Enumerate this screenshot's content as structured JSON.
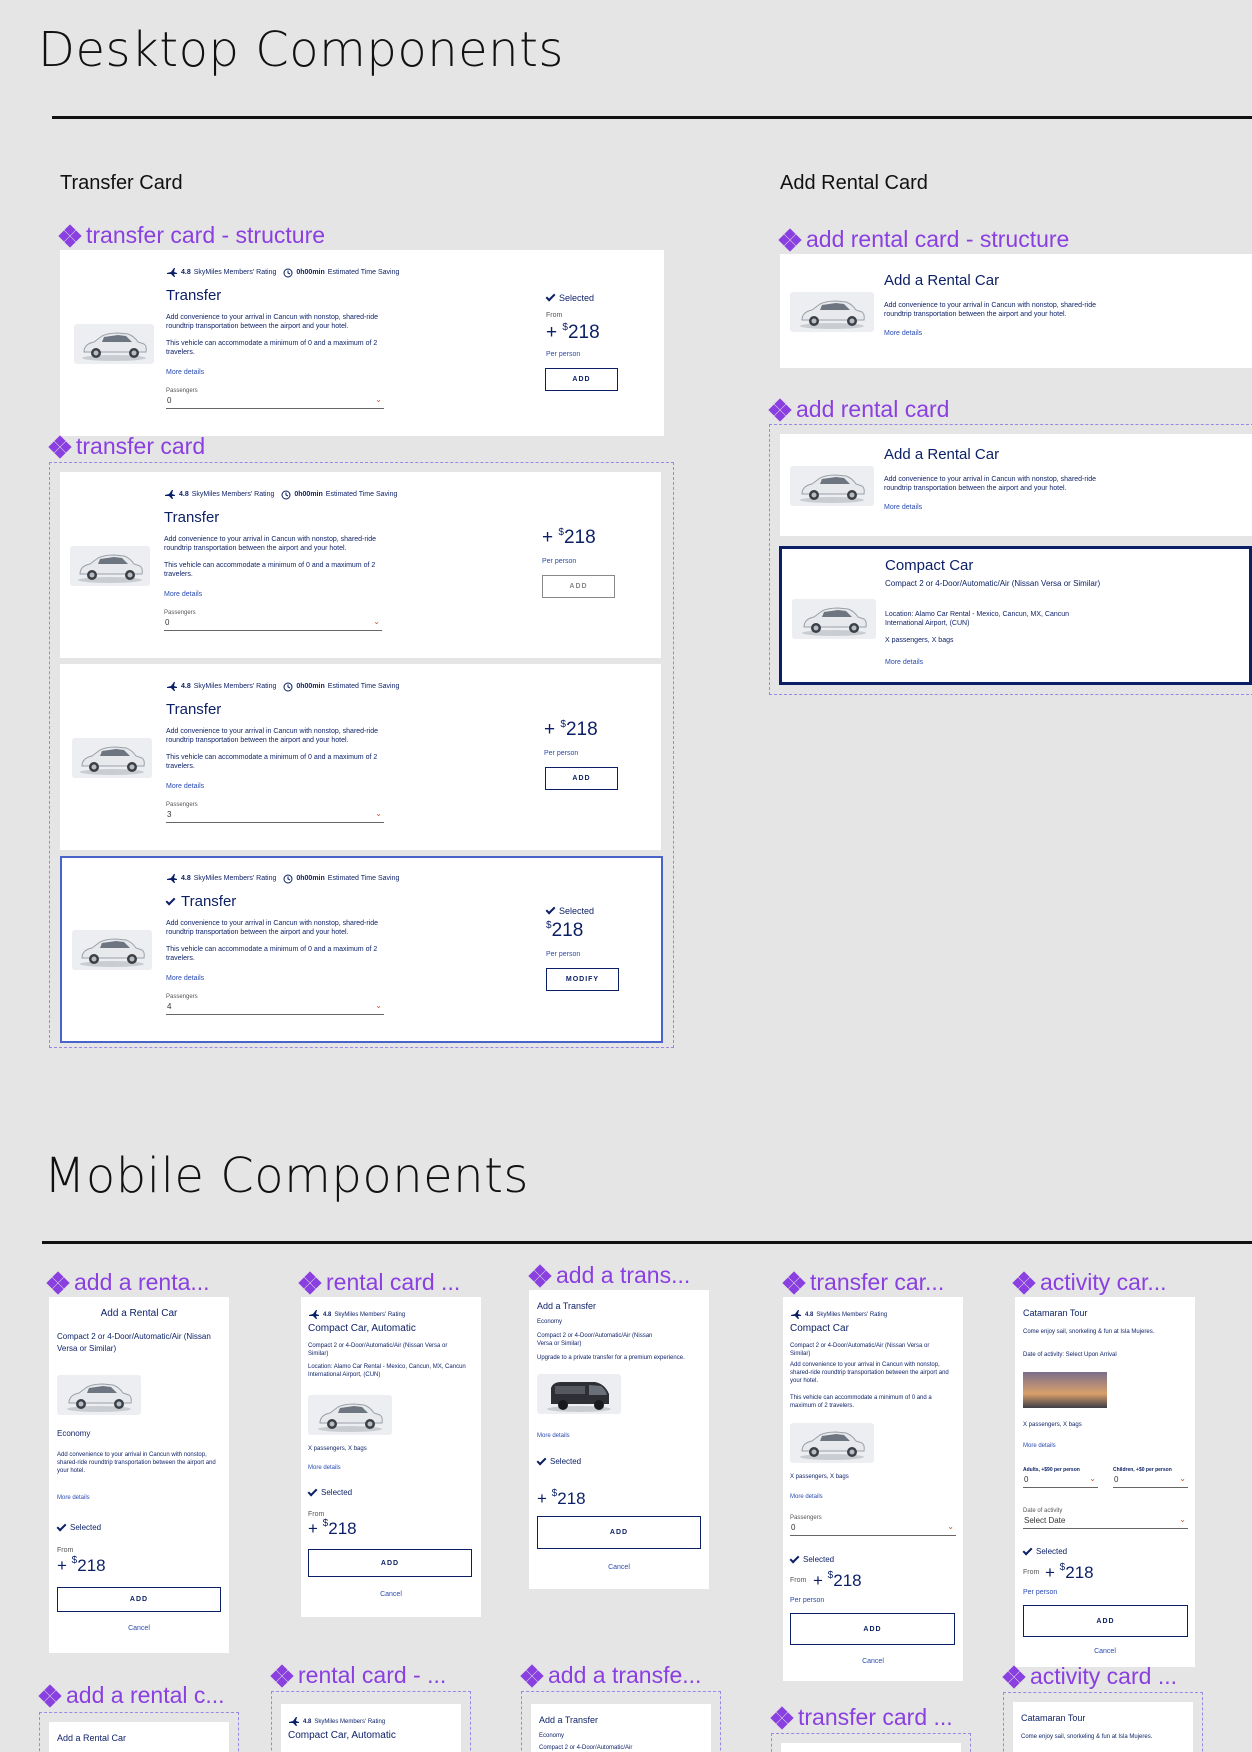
{
  "desktop": {
    "title": "Desktop Components",
    "transfer_card_heading": "Transfer Card",
    "add_rental_heading": "Add Rental Card"
  },
  "mobile": {
    "title": "Mobile Components"
  },
  "labels": {
    "transfer_structure": "transfer card - structure",
    "transfer_card": "transfer card",
    "add_rental_structure": "add rental card - structure",
    "add_rental_card": "add rental card",
    "m_add_renta": "add a renta...",
    "m_rental_card": "rental card ...",
    "m_add_trans": "add a trans...",
    "m_transfer_car": "transfer car...",
    "m_activity_car": "activity car...",
    "m_add_rental_c": "add a rental c...",
    "m_rental_card_dash": "rental card - ...",
    "m_add_transfe": "add a transfe...",
    "m_transfer_card_dots": "transfer card ...",
    "m_activity_card_dots": "activity card ..."
  },
  "transfer": {
    "rating_value": "4.8",
    "rating_label": "SkyMiles Members' Rating",
    "time_value": "0h00min",
    "time_label": "Estimated Time Saving",
    "title": "Transfer",
    "desc1": "Add convenience to your arrival in Cancun with nonstop, shared-ride roundtrip transportation between the airport and your hotel.",
    "desc2": "This vehicle can accommodate a minimum of 0 and a maximum of 2 travelers.",
    "more_details": "More details",
    "passengers_label": "Passengers",
    "selected": "Selected",
    "from": "From",
    "plus": "+",
    "currency": "$",
    "price": "218",
    "per_person": "Per person",
    "add": "ADD",
    "modify": "MODIFY",
    "chevron": "⌄",
    "variants": [
      {
        "passengers": "0"
      },
      {
        "passengers": "0"
      },
      {
        "passengers": "3"
      },
      {
        "passengers": "4"
      }
    ]
  },
  "rental": {
    "title": "Add a Rental Car",
    "desc": "Add convenience to your arrival in Cancun with nonstop, shared-ride roundtrip transportation between the airport and your hotel.",
    "more_details": "More details",
    "compact_title": "Compact Car",
    "compact_sub": "Compact 2 or 4-Door/Automatic/Air (Nissan Versa or Similar)",
    "location": "Location: Alamo Car Rental - Mexico, Cancun, MX, Cancun International Airport, (CUN)",
    "pax_bags": "X passengers, X bags"
  },
  "mobile_cards": {
    "add_rental": {
      "title": "Add a Rental Car",
      "sub": "Compact 2 or 4-Door/Automatic/Air (Nissan Versa or Similar)",
      "category": "Economy",
      "desc": "Add convenience to your arrival in Cancun with nonstop, shared-ride roundtrip transportation between the airport and your hotel.",
      "more": "More details",
      "selected": "Selected",
      "from": "From",
      "price_prefix": "+",
      "currency": "$",
      "price": "218",
      "add": "ADD",
      "cancel": "Cancel"
    },
    "rental": {
      "rating": "4.8",
      "rating_label": "SkyMiles Members' Rating",
      "title": "Compact Car, Automatic",
      "sub": "Compact 2 or 4-Door/Automatic/Air (Nissan Versa or Similar)",
      "location": "Location: Alamo Car Rental - Mexico, Cancun, MX, Cancun International Airport, (CUN)",
      "pax": "X passengers, X bags",
      "more": "More details",
      "selected": "Selected",
      "from": "From",
      "price": "218",
      "add": "ADD",
      "cancel": "Cancel"
    },
    "add_transfer": {
      "title": "Add a Transfer",
      "category": "Economy",
      "sub": "Compact 2 or 4-Door/Automatic/Air (Nissan Versa or Similar)",
      "desc": "Upgrade to a private transfer for a premium experience.",
      "more": "More details",
      "selected": "Selected",
      "price": "218",
      "add": "ADD",
      "cancel": "Cancel"
    },
    "transfer": {
      "rating": "4.8",
      "rating_label": "SkyMiles Members' Rating",
      "title": "Compact Car",
      "sub": "Compact 2 or 4-Door/Automatic/Air (Nissan Versa or Similar)",
      "desc1": "Add convenience to your arrival in Cancun with nonstop, shared-ride roundtrip transportation between the airport and your hotel.",
      "desc2": "This vehicle can accommodate a minimum of 0 and a maximum of 2 travelers.",
      "pax": "X passengers, X bags",
      "more": "More details",
      "passengers_label": "Passengers",
      "passengers": "0",
      "selected": "Selected",
      "from": "From",
      "price": "218",
      "per_person": "Per person",
      "add": "ADD",
      "cancel": "Cancel"
    },
    "activity": {
      "title": "Catamaran Tour",
      "desc": "Come enjoy sail, snorkeling & fun at Isla Mujeres.",
      "date_info": "Date of activity: Select Upon Arrival",
      "pax": "X passengers, X bags",
      "more": "More details",
      "adults_label": "Adults, +$90 per person",
      "adults": "0",
      "children_label": "Children, +$0 per person",
      "children": "0",
      "date_label": "Date of activity",
      "date_value": "Select Date",
      "selected": "Selected",
      "from": "From",
      "price": "218",
      "per_person": "Per person",
      "add": "ADD",
      "cancel": "Cancel"
    },
    "add_rental_bottom": {
      "title": "Add a Rental Car"
    },
    "rental_bottom": {
      "rating": "4.8",
      "rating_label": "SkyMiles Members' Rating",
      "title": "Compact Car, Automatic"
    },
    "add_transfer_bottom": {
      "title": "Add a Transfer",
      "category": "Economy",
      "sub": "Compact 2 or 4-Door/Automatic/Air"
    },
    "activity_bottom": {
      "title": "Catamaran Tour",
      "desc": "Come enjoy sail, snorkeling & fun at Isla Mujeres."
    }
  }
}
